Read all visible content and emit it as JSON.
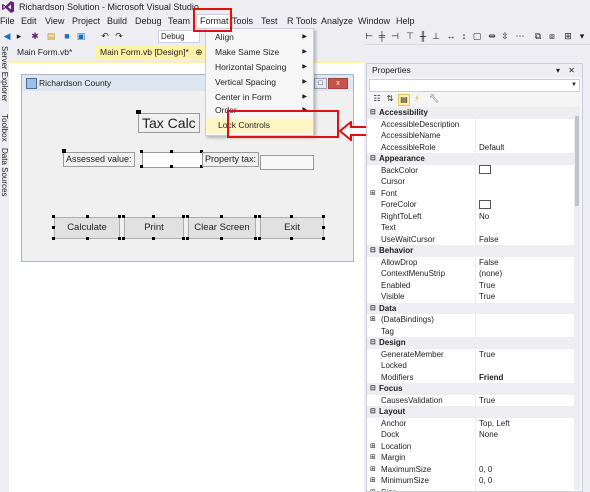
{
  "window": {
    "title": "Richardson Solution - Microsoft Visual Studio"
  },
  "menubar": {
    "items": [
      "File",
      "Edit",
      "View",
      "Project",
      "Build",
      "Debug",
      "Team",
      "Format",
      "Tools",
      "Test",
      "R Tools",
      "Analyze",
      "Window",
      "Help"
    ]
  },
  "toolbar": {
    "configuration": "Debug"
  },
  "left_strip": {
    "items": [
      "Server Explorer",
      "Toolbox",
      "Data Sources"
    ]
  },
  "doc_tabs": {
    "tab1": "Main Form.vb*",
    "tab2": "Main Form.vb [Design]*",
    "tab2_pin": "⊕",
    "tab2_close": "✕"
  },
  "form": {
    "title": "Richardson County",
    "heading": "Tax Calc",
    "assessed_label": "Assessed value:",
    "tax_label": "Property tax:",
    "buttons": [
      "Calculate",
      "Print",
      "Clear Screen",
      "Exit"
    ]
  },
  "format_menu": {
    "items": [
      {
        "label": "Align",
        "submenu": true
      },
      {
        "label": "Make Same Size",
        "submenu": true
      },
      {
        "label": "Horizontal Spacing",
        "submenu": true
      },
      {
        "label": "Vertical Spacing",
        "submenu": true
      },
      {
        "label": "Center in Form",
        "submenu": true
      },
      {
        "label": "Order",
        "submenu": true
      },
      {
        "label": "Lock Controls",
        "submenu": false
      }
    ]
  },
  "properties": {
    "title": "Properties",
    "title_controls": "▾ ✕",
    "rows": [
      {
        "kind": "cat",
        "name": "Accessibility"
      },
      {
        "kind": "prop",
        "name": "AccessibleDescription",
        "value": ""
      },
      {
        "kind": "prop",
        "name": "AccessibleName",
        "value": ""
      },
      {
        "kind": "prop",
        "name": "AccessibleRole",
        "value": "Default"
      },
      {
        "kind": "cat",
        "name": "Appearance"
      },
      {
        "kind": "prop",
        "name": "BackColor",
        "value": "",
        "swatch": true
      },
      {
        "kind": "prop",
        "name": "Cursor",
        "value": ""
      },
      {
        "kind": "prop",
        "name": "Font",
        "value": "",
        "expand": true
      },
      {
        "kind": "prop",
        "name": "ForeColor",
        "value": "",
        "swatch": true
      },
      {
        "kind": "prop",
        "name": "RightToLeft",
        "value": "No"
      },
      {
        "kind": "prop",
        "name": "Text",
        "value": ""
      },
      {
        "kind": "prop",
        "name": "UseWaitCursor",
        "value": "False"
      },
      {
        "kind": "cat",
        "name": "Behavior"
      },
      {
        "kind": "prop",
        "name": "AllowDrop",
        "value": "False"
      },
      {
        "kind": "prop",
        "name": "ContextMenuStrip",
        "value": "(none)"
      },
      {
        "kind": "prop",
        "name": "Enabled",
        "value": "True"
      },
      {
        "kind": "prop",
        "name": "Visible",
        "value": "True"
      },
      {
        "kind": "cat",
        "name": "Data"
      },
      {
        "kind": "prop",
        "name": "(DataBindings)",
        "value": "",
        "expand": true
      },
      {
        "kind": "prop",
        "name": "Tag",
        "value": ""
      },
      {
        "kind": "cat",
        "name": "Design"
      },
      {
        "kind": "prop",
        "name": "GenerateMember",
        "value": "True"
      },
      {
        "kind": "prop",
        "name": "Locked",
        "value": ""
      },
      {
        "kind": "prop",
        "name": "Modifiers",
        "value": "Friend",
        "bold": true
      },
      {
        "kind": "cat",
        "name": "Focus"
      },
      {
        "kind": "prop",
        "name": "CausesValidation",
        "value": "True"
      },
      {
        "kind": "cat",
        "name": "Layout"
      },
      {
        "kind": "prop",
        "name": "Anchor",
        "value": "Top, Left"
      },
      {
        "kind": "prop",
        "name": "Dock",
        "value": "None"
      },
      {
        "kind": "prop",
        "name": "Location",
        "value": "",
        "expand": true
      },
      {
        "kind": "prop",
        "name": "Margin",
        "value": "",
        "expand": true
      },
      {
        "kind": "prop",
        "name": "MaximumSize",
        "value": "0, 0",
        "expand": true
      },
      {
        "kind": "prop",
        "name": "MinimumSize",
        "value": "0, 0",
        "expand": true
      },
      {
        "kind": "prop",
        "name": "Size",
        "value": "",
        "expand": true
      }
    ]
  },
  "colors": {
    "highlight_red": "#e01010",
    "active_tab": "#fff1a6",
    "menu_hover": "#fff5c5"
  }
}
